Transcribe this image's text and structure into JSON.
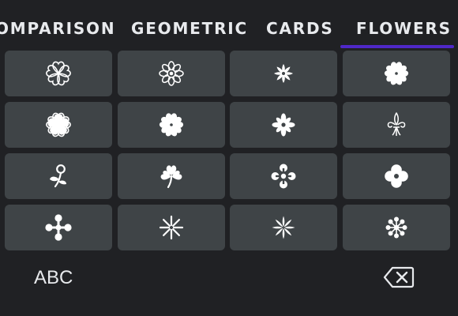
{
  "tabs": [
    {
      "label": "OMPARISON"
    },
    {
      "label": "GEOMETRIC"
    },
    {
      "label": "CARDS"
    },
    {
      "label": "FLOWERS"
    }
  ],
  "selected_tab": "FLOWERS",
  "colors": {
    "background": "#202124",
    "key": "#3f4447",
    "accent": "#4f28c8",
    "glyph": "#ffffff"
  },
  "symbols": [
    [
      "outlined-florette-icon",
      "eight-petal-rosette-icon",
      "eight-teardrop-florette-icon",
      "black-florette-icon"
    ],
    [
      "outlined-black-florette-icon",
      "black-florette-icon",
      "eight-petal-black-florette-icon",
      "fleur-de-lis-icon"
    ],
    [
      "rosette-sprig-icon",
      "shamrock-icon",
      "four-balloon-spoked-asterisk-icon",
      "four-petal-balloon-icon"
    ],
    [
      "four-club-spoked-asterisk-icon",
      "eight-spoked-asterisk-icon",
      "eight-teardrop-asterisk-icon",
      "eight-balloon-asterisk-icon"
    ]
  ],
  "bottom_bar": {
    "switch_label": "ABC",
    "delete_icon": "backspace-icon"
  }
}
